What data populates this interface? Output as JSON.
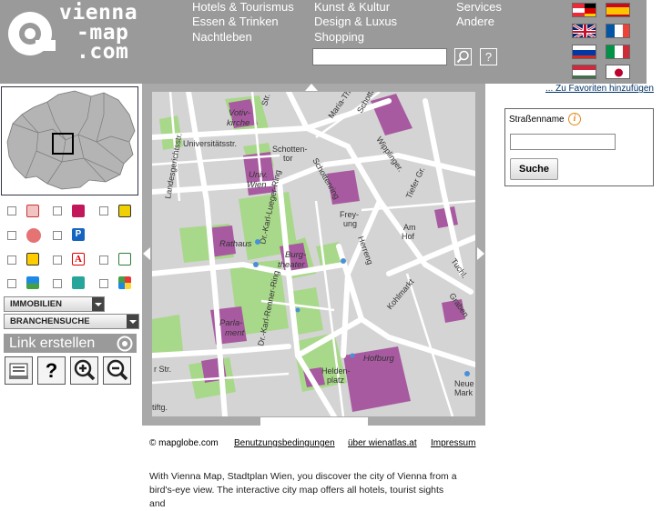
{
  "logo": {
    "line1": "vienna",
    "line2": "-map",
    "line3": ".com"
  },
  "nav": {
    "col1": [
      "Hotels & Tourismus",
      "Essen & Trinken",
      "Nachtleben"
    ],
    "col2": [
      "Kunst & Kultur",
      "Design & Luxus",
      "Shopping"
    ],
    "col3": [
      "Services",
      "Andere"
    ]
  },
  "search": {
    "value": "",
    "help_label": "?"
  },
  "flags": [
    "austria-flag",
    "spain-flag",
    "uk-flag",
    "france-flag",
    "russia-flag",
    "italy-flag",
    "hungary-flag",
    "japan-flag"
  ],
  "dropdowns": {
    "immobilien": "IMMOBILIEN",
    "branchensuche": "BRANCHENSUCHE"
  },
  "link_button": "Link erstellen",
  "tools": {
    "help_label": "?"
  },
  "map_labels": {
    "votivkirche": "Votiv-\nkirche",
    "universitaetsstr": "Universitätsstr.",
    "landesgerichtsstr": "Landesgerichtsstr.",
    "schottentor": "Schotten-\ntor",
    "univ_wien": "Univ.\nWien",
    "schottenring": "Schottenring",
    "maria_th": "Maria-Th.",
    "schotten_top": "Schotten",
    "wipplinger": "Wipplinger.",
    "rathaus": "Rathaus",
    "karl_lueger": "Dr.-Karl-Lueger-Ring",
    "burgtheater": "Burg-\ntheater",
    "freyung": "Frey-\nung",
    "herreng": "Herreng",
    "am_hof": "Am\nHof",
    "tiefer_gr": "Tiefer Gr.",
    "tuchl": "Tuchl.",
    "parlament": "Parla-\nment",
    "karl_renner": "Dr.-Karl-Renner-Ring",
    "kohlmarkt": "Kohlmarkt",
    "graben": "Graben",
    "heldenplatz": "Helden-\nplatz",
    "hofburg": "Hofburg",
    "neuer_markt": "Neue\nMarkt",
    "str_top": "Str.",
    "str_left": "r Str.",
    "tiftg": "tiftg."
  },
  "right_panel": {
    "favorites": "... Zu Favoriten hinzufügen",
    "street_label": "Straßenname",
    "street_value": "",
    "submit": "Suche"
  },
  "footer": {
    "copyright": "© mapglobe.com",
    "links": [
      "Benutzungsbedingungen",
      "über wienatlas.at",
      "Impressum"
    ],
    "description": "With Vienna Map, Stadtplan Wien, you discover the city of Vienna from a bird's-eye view. The interactive city map offers all hotels, tourist sights and"
  }
}
